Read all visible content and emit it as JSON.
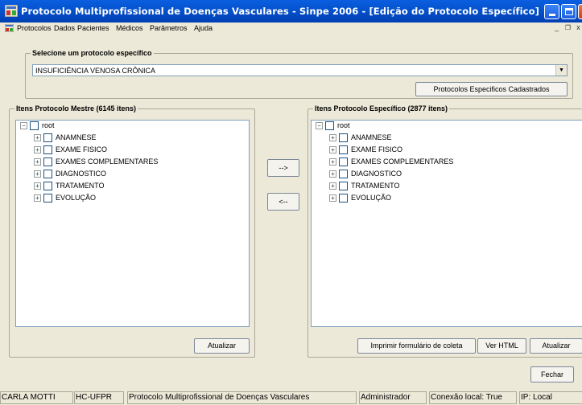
{
  "window": {
    "title": "Protocolo Multiprofissional de Doenças Vasculares - Sinpe 2006 - [Edição do Protocolo Específico]"
  },
  "menu": {
    "items": [
      "Protocolos",
      "Dados",
      "Pacientes",
      "Médicos",
      "Parâmetros",
      "Ajuda"
    ]
  },
  "select_protocol": {
    "legend": "Selecione um protocolo específico",
    "selected": "INSUFICIÊNCIA VENOSA  CRÔNICA",
    "registered_button": "Protocolos Especificos Cadastrados"
  },
  "master": {
    "legend": "Itens Protocolo Mestre (6145 itens)",
    "root": "root",
    "items": [
      "ANAMNESE",
      "EXAME FISICO",
      "EXAMES COMPLEMENTARES",
      "DIAGNOSTICO",
      "TRATAMENTO",
      "EVOLUÇÃO"
    ],
    "refresh_button": "Atualizar"
  },
  "transfer": {
    "add_button": "-->",
    "remove_button": "<--"
  },
  "specific": {
    "legend": "Itens Protocolo Específico (2877 itens)",
    "root": "root",
    "items": [
      "ANAMNESE",
      "EXAME FISICO",
      "EXAMES COMPLEMENTARES",
      "DIAGNOSTICO",
      "TRATAMENTO",
      "EVOLUÇÃO"
    ],
    "print_button": "Imprimir formulário de coleta",
    "html_button": "Ver HTML",
    "refresh_button": "Atualizar"
  },
  "close_button": "Fechar",
  "status": {
    "user": "CARLA MOTTI",
    "institution": "HC-UFPR",
    "protocol": "Protocolo Multiprofissional de Doenças Vasculares",
    "role": "Administrador",
    "connection": "Conexão local: True",
    "ip": "IP: Local"
  },
  "colors": {
    "titlebar": "#0553cf",
    "window_bg": "#ece9d8",
    "close_button": "#c8401d"
  }
}
